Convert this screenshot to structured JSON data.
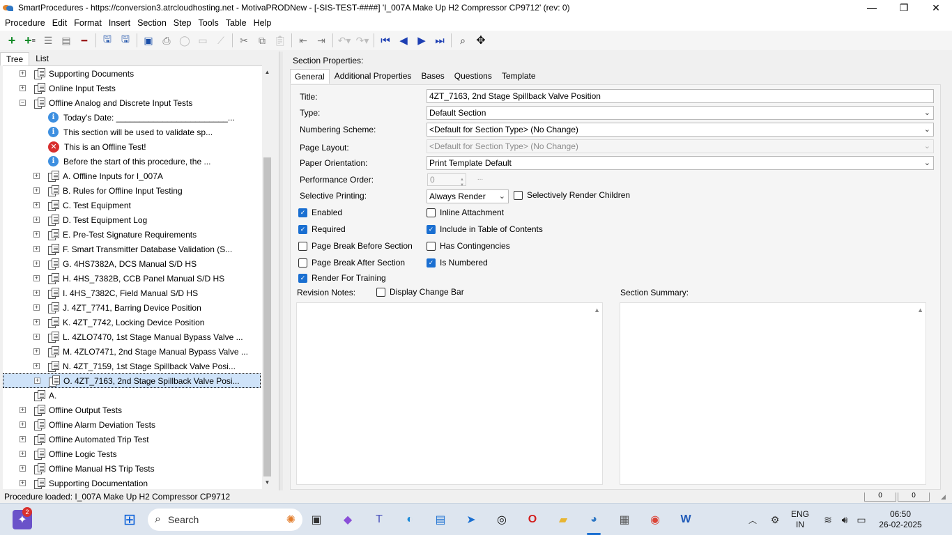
{
  "window": {
    "title": "SmartProcedures - https://conversion3.atrcloudhosting.net - MotivaPRODNew - [-SIS-TEST-####] 'I_007A Make Up H2 Compressor CP9712' (rev: 0)",
    "controls": [
      "—",
      "❐",
      "✕"
    ]
  },
  "menubar": [
    "Procedure",
    "Edit",
    "Format",
    "Insert",
    "Section",
    "Step",
    "Tools",
    "Table",
    "Help"
  ],
  "left_tabs": [
    "Tree",
    "List"
  ],
  "tree": [
    {
      "label": "Supporting Documents",
      "indent": 0,
      "icon": "doc",
      "expander": "+"
    },
    {
      "label": "Online Input Tests",
      "indent": 0,
      "icon": "doc",
      "expander": "+"
    },
    {
      "label": "Offline Analog and Discrete Input Tests",
      "indent": 0,
      "icon": "doc",
      "expander": "−"
    },
    {
      "label": "Today's Date: ________________________...",
      "indent": 1,
      "icon": "info"
    },
    {
      "label": "This section will be used to validate sp...",
      "indent": 1,
      "icon": "info"
    },
    {
      "label": "This is an Offline Test!",
      "indent": 1,
      "icon": "error"
    },
    {
      "label": "Before the start of this procedure, the ...",
      "indent": 1,
      "icon": "info"
    },
    {
      "label": "A. Offline Inputs for I_007A",
      "indent": 1,
      "icon": "doc",
      "expander": "+"
    },
    {
      "label": "B. Rules for Offline Input Testing",
      "indent": 1,
      "icon": "doc",
      "expander": "+"
    },
    {
      "label": "C. Test Equipment",
      "indent": 1,
      "icon": "doc",
      "expander": "+"
    },
    {
      "label": "D. Test Equipment Log",
      "indent": 1,
      "icon": "doc",
      "expander": "+"
    },
    {
      "label": "E. Pre-Test Signature Requirements",
      "indent": 1,
      "icon": "doc",
      "expander": "+"
    },
    {
      "label": "F. Smart Transmitter Database Validation (S...",
      "indent": 1,
      "icon": "doc",
      "expander": "+"
    },
    {
      "label": "G. 4HS7382A, DCS Manual S/D HS",
      "indent": 1,
      "icon": "doc",
      "expander": "+"
    },
    {
      "label": "H. 4HS_7382B, CCB Panel Manual S/D HS",
      "indent": 1,
      "icon": "doc",
      "expander": "+"
    },
    {
      "label": "I. 4HS_7382C, Field Manual S/D HS",
      "indent": 1,
      "icon": "doc",
      "expander": "+"
    },
    {
      "label": "J. 4ZT_7741, Barring Device Position",
      "indent": 1,
      "icon": "doc",
      "expander": "+"
    },
    {
      "label": "K. 4ZT_7742, Locking Device Position",
      "indent": 1,
      "icon": "doc",
      "expander": "+"
    },
    {
      "label": "L. 4ZLO7470, 1st Stage Manual Bypass Valve ...",
      "indent": 1,
      "icon": "doc",
      "expander": "+"
    },
    {
      "label": "M. 4ZLO7471, 2nd Stage Manual Bypass Valve ...",
      "indent": 1,
      "icon": "doc",
      "expander": "+"
    },
    {
      "label": "N. 4ZT_7159, 1st Stage Spillback Valve Posi...",
      "indent": 1,
      "icon": "doc",
      "expander": "+"
    },
    {
      "label": "O. 4ZT_7163, 2nd Stage Spillback Valve Posi...",
      "indent": 1,
      "icon": "doc",
      "expander": "+",
      "selected": true
    },
    {
      "label": "A.",
      "indent": 0,
      "icon": "doc"
    },
    {
      "label": "Offline Output Tests",
      "indent": 0,
      "icon": "doc",
      "expander": "+"
    },
    {
      "label": "Offline Alarm Deviation Tests",
      "indent": 0,
      "icon": "doc",
      "expander": "+"
    },
    {
      "label": "Offline Automated Trip Test",
      "indent": 0,
      "icon": "doc",
      "expander": "+"
    },
    {
      "label": "Offline Logic Tests",
      "indent": 0,
      "icon": "doc",
      "expander": "+"
    },
    {
      "label": "Offline Manual HS Trip Tests",
      "indent": 0,
      "icon": "doc",
      "expander": "+"
    },
    {
      "label": "Supporting Documentation",
      "indent": 0,
      "icon": "doc",
      "expander": "+"
    }
  ],
  "section_properties": {
    "heading": "Section Properties:",
    "tabs": [
      "General",
      "Additional Properties",
      "Bases",
      "Questions",
      "Template"
    ],
    "labels": {
      "title": "Title:",
      "type": "Type:",
      "numbering": "Numbering Scheme:",
      "layout": "Page Layout:",
      "orientation": "Paper Orientation:",
      "perf_order": "Performance Order:",
      "selective": "Selective Printing:",
      "revision_notes": "Revision Notes:",
      "summary": "Section Summary:"
    },
    "values": {
      "title": "4ZT_7163, 2nd Stage Spillback Valve Position",
      "type": "Default Section",
      "numbering": "<Default for Section Type> (No Change)",
      "layout": "<Default for Section Type> (No Change)",
      "orientation": "Print Template Default",
      "perf_order": "0",
      "perf_extra": "...",
      "selective": "Always Render"
    },
    "checkboxes": {
      "selectively_render_children": {
        "label": "Selectively Render Children",
        "checked": false
      },
      "enabled": {
        "label": "Enabled",
        "checked": true
      },
      "inline_attachment": {
        "label": "Inline Attachment",
        "checked": false
      },
      "required": {
        "label": "Required",
        "checked": true
      },
      "include_toc": {
        "label": "Include in Table of Contents",
        "checked": true
      },
      "page_break_before": {
        "label": "Page Break Before Section",
        "checked": false
      },
      "has_contingencies": {
        "label": "Has Contingencies",
        "checked": false
      },
      "page_break_after": {
        "label": "Page Break After Section",
        "checked": false
      },
      "is_numbered": {
        "label": "Is Numbered",
        "checked": true
      },
      "render_training": {
        "label": "Render For Training",
        "checked": true
      },
      "display_change_bar": {
        "label": "Display Change Bar",
        "checked": false
      }
    }
  },
  "statusbar": {
    "text": "Procedure loaded: I_007A Make Up H2 Compressor CP9712",
    "box1": "0",
    "box2": "0"
  },
  "taskbar": {
    "search": "Search",
    "notif_badge": "2",
    "lang": "ENG",
    "region": "IN",
    "time": "06:50",
    "date": "26-02-2025"
  },
  "colors": {
    "accent": "#1a6fd1",
    "selection": "#cfe3f9",
    "taskbar": "#dde5ef"
  }
}
